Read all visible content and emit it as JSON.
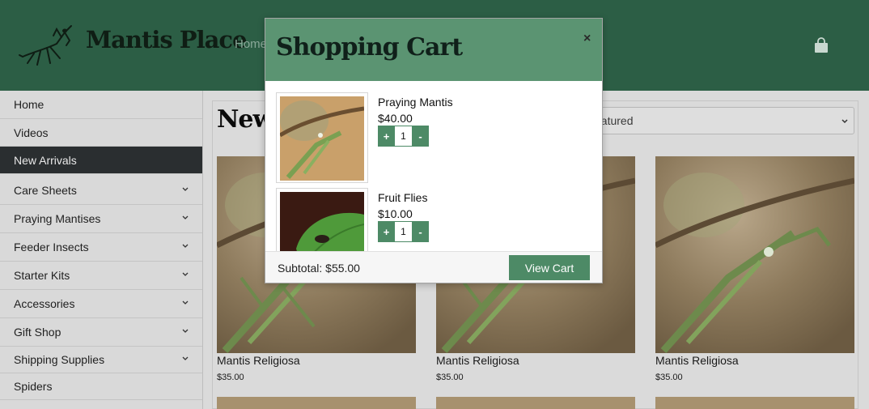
{
  "header": {
    "logo_text": "Mantis Place",
    "nav_home": "Home"
  },
  "sidebar": {
    "items": [
      {
        "label": "Home",
        "active": false,
        "has_chevron": false
      },
      {
        "label": "Videos",
        "active": false,
        "has_chevron": false
      },
      {
        "label": "New Arrivals",
        "active": true,
        "has_chevron": false
      },
      {
        "label": "Care Sheets",
        "active": false,
        "has_chevron": true
      },
      {
        "label": "Praying Mantises",
        "active": false,
        "has_chevron": true
      },
      {
        "label": "Feeder Insects",
        "active": false,
        "has_chevron": true
      },
      {
        "label": "Starter Kits",
        "active": false,
        "has_chevron": true
      },
      {
        "label": "Accessories",
        "active": false,
        "has_chevron": true
      },
      {
        "label": "Gift Shop",
        "active": false,
        "has_chevron": true
      },
      {
        "label": "Shipping Supplies",
        "active": false,
        "has_chevron": true
      },
      {
        "label": "Spiders",
        "active": false,
        "has_chevron": false
      }
    ]
  },
  "main": {
    "title_visible": "New",
    "sort_selected": "eatured",
    "products": [
      {
        "name": "Mantis Religiosa",
        "price": "$35.00"
      },
      {
        "name": "Mantis Religiosa",
        "price": "$35.00"
      },
      {
        "name": "Mantis Religiosa",
        "price": "$35.00"
      }
    ]
  },
  "cart": {
    "title": "Shopping Cart",
    "close_glyph": "×",
    "items": [
      {
        "name": "Praying Mantis",
        "price": "$40.00",
        "qty": "1",
        "plus": "+",
        "minus": "-"
      },
      {
        "name": "Fruit Flies",
        "price": "$10.00",
        "qty": "1",
        "plus": "+",
        "minus": "-"
      }
    ],
    "subtotal": "Subtotal: $55.00",
    "view_cart_label": "View Cart"
  },
  "colors": {
    "header_green": "#2c5e45",
    "modal_header_green": "#5b9472",
    "button_green": "#4d8a66",
    "sidebar_active": "#2a2e30"
  }
}
